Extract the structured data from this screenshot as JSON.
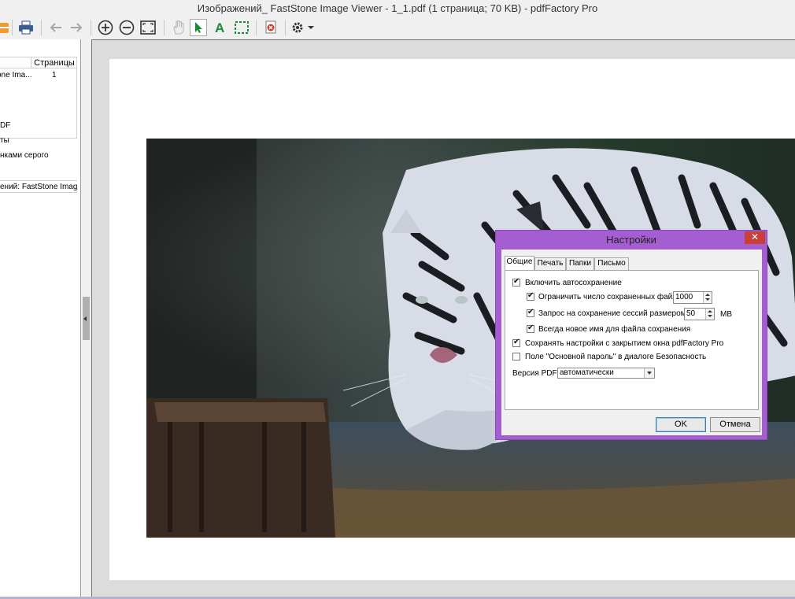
{
  "window": {
    "title": "Изображений_ FastStone Image Viewer - 1_1.pdf (1 страница; 70 KB) - pdfFactory Pro"
  },
  "toolbar": {
    "icons": [
      "orange-icon",
      "print-icon",
      "back-arrow-icon",
      "forward-arrow-icon",
      "zoom-in-icon",
      "zoom-out-icon",
      "fit-page-icon",
      "hand-tool-icon",
      "select-tool-icon",
      "text-tool-icon",
      "marquee-tool-icon",
      "delete-page-icon",
      "settings-icon"
    ]
  },
  "left_panel": {
    "table": {
      "header": "Страницы",
      "rows": [
        {
          "title": "one Ima...",
          "pages": "1"
        }
      ]
    },
    "items": [
      "DF",
      "ты",
      "нками серого"
    ],
    "document_field": "ений: FastStone Image V"
  },
  "dialog": {
    "title": "Настройки",
    "close_label": "✕",
    "tabs": [
      "Общие",
      "Печать",
      "Папки",
      "Письмо"
    ],
    "selected_tab": "Общие",
    "options": {
      "autosave": {
        "label": "Включить автосохранение",
        "checked": true
      },
      "limit_files": {
        "label": "Ограничить число сохраненных файлов",
        "checked": true,
        "value": "1000"
      },
      "ask_size": {
        "label": "Запрос на сохранение сессий размером >",
        "checked": true,
        "value": "50",
        "unit": "MB"
      },
      "new_name": {
        "label": "Всегда новое имя для файла сохранения",
        "checked": true
      },
      "save_settings": {
        "label": "Сохранять настройки с закрытием окна pdfFactory Pro",
        "checked": true
      },
      "master_password": {
        "label": "Поле \"Основной пароль\" в диалоге Безопасность",
        "checked": false
      }
    },
    "pdf_version": {
      "label": "Версия PDF:",
      "value": "автоматически"
    },
    "ok_label": "OK",
    "cancel_label": "Отмена"
  },
  "colors": {
    "dialog_frame": "#a45ed1",
    "close_button": "#c7413a"
  }
}
